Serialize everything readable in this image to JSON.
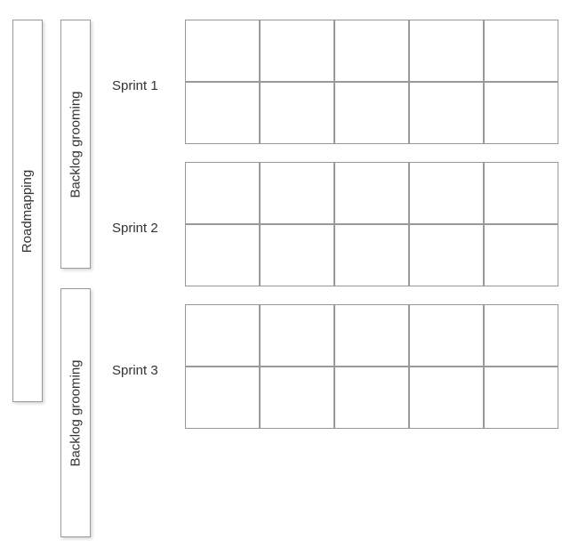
{
  "roadmapping": "Roadmapping",
  "backlog_grooming_1": "Backlog grooming",
  "backlog_grooming_2": "Backlog grooming",
  "sprints": [
    {
      "label": "Sprint 1",
      "rows": 2,
      "cols": 5
    },
    {
      "label": "Sprint 2",
      "rows": 2,
      "cols": 5
    },
    {
      "label": "Sprint 3",
      "rows": 2,
      "cols": 5
    }
  ]
}
